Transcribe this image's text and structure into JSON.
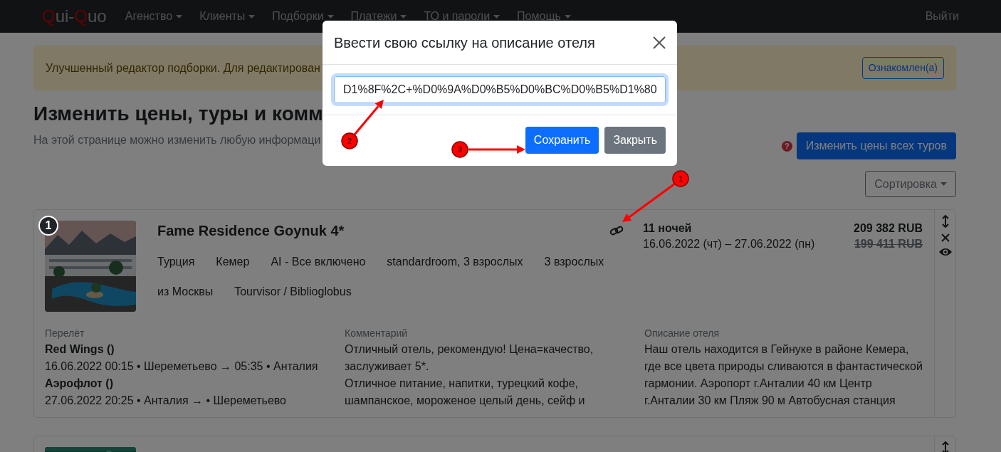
{
  "navbar": {
    "logo": [
      {
        "text": "Q",
        "accent": true
      },
      {
        "text": "ui-",
        "accent": false
      },
      {
        "text": "Q",
        "accent": true
      },
      {
        "text": "uo",
        "accent": false
      }
    ],
    "menu": [
      {
        "label": "Агенство"
      },
      {
        "label": "Клиенты"
      },
      {
        "label": "Подборки"
      },
      {
        "label": "Платежи"
      },
      {
        "label": "ТО и пароли"
      },
      {
        "label": "Помощь"
      }
    ],
    "logout": "Выйти"
  },
  "alert": {
    "text": "Улучшенный редактор подборки. Для редактирован",
    "button": "Ознакомлен(а)"
  },
  "page": {
    "title": "Изменить цены, туры и комм",
    "subtitle": "На этой странице можно изменить любую информаци",
    "help": "?",
    "change_all_button": "Изменить цены всех туров",
    "sort_button": "Сортировка"
  },
  "cards": [
    {
      "number": "1",
      "image": {
        "kind": "picture"
      },
      "title": "Fame Residence Goynuk 4*",
      "tag_rows": [
        [
          "Турция",
          "Кемер",
          "AI - Все включено",
          "standardroom, 3 взрослых",
          "3 взрослых"
        ],
        [
          "из Москвы",
          "Tourvisor / Biblioglobus"
        ]
      ],
      "nights": "11 ночей",
      "dates": "16.06.2022 (чт) – 27.06.2022 (пн)",
      "price": "209 382 RUB",
      "old_price": "199 411 RUB",
      "flight": {
        "label": "Перелёт",
        "lines": [
          {
            "kind": "airline",
            "text": "Red Wings ()"
          },
          {
            "kind": "route",
            "text": "16.06.2022 00:15 • Шереметьево → 05:35 • Анталия"
          },
          {
            "kind": "airline",
            "text": "Аэрофлот ()"
          },
          {
            "kind": "route",
            "text": "27.06.2022 20:25 • Анталия →  • Шереметьево"
          }
        ]
      },
      "comment": {
        "label": "Комментарий",
        "lines": [
          "Отличный отель, рекомендую! Цена=качество,",
          "заслуживает 5*.",
          "Отличное питание, напитки, турецкий кофе,",
          "шампанское, мороженое целый день, сейф и"
        ]
      },
      "description": {
        "label": "Описание отеля",
        "lines": [
          "Наш отель находится в Гейнуке в районе Кемера,",
          "где все цвета природы сливаются в фантастической",
          "гармонии. Аэропорт г.Анталии 40 км Центр",
          "г.Анталии 30 км Пляж 90 м Автобусная станция"
        ]
      }
    },
    {
      "image": {
        "kind": "picture"
      }
    }
  ],
  "modal": {
    "title": "Ввести свою ссылку на описание отеля",
    "value": "D1%8F%2C+%D0%9A%D0%B5%D0%BC%D0%B5%D1%80",
    "save_button": "Сохранить",
    "close_button": "Закрыть"
  },
  "annotations": [
    {
      "label": "1"
    },
    {
      "label": "2"
    },
    {
      "label": "3"
    }
  ]
}
